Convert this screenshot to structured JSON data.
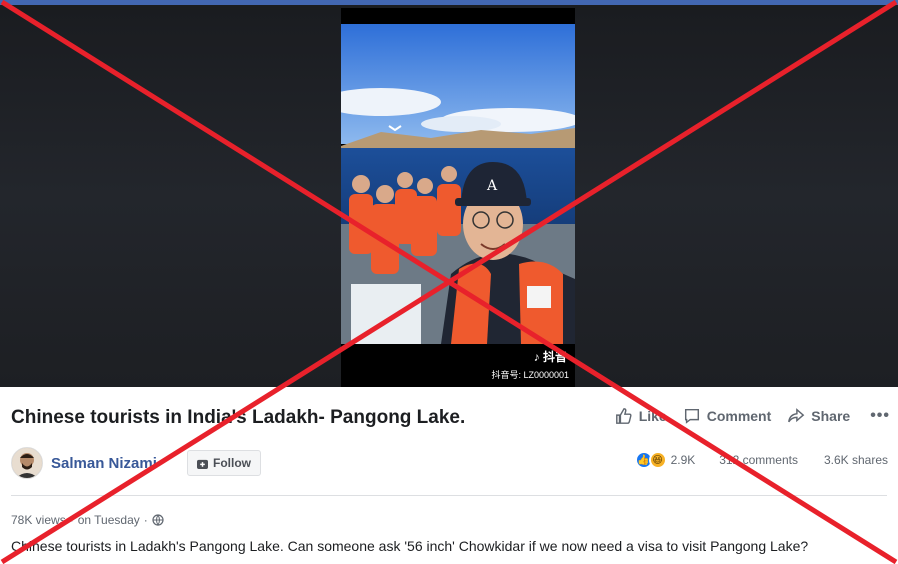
{
  "video": {
    "watermark_logo": "抖音",
    "watermark_id": "抖音号: LZ0000001"
  },
  "post": {
    "title": "Chinese tourists in India's Ladakh- Pangong Lake.",
    "author": "Salman Nizami",
    "follow_label": "Follow",
    "actions": {
      "like": "Like",
      "comment": "Comment",
      "share": "Share",
      "more": "•••"
    },
    "reactions_count": "2.9K",
    "comments_count": "312 comments",
    "shares_count": "3.6K shares",
    "views": "78K views",
    "posted": "on Tuesday",
    "caption": "Chinese tourists in Ladakh's Pangong Lake. Can someone ask '56 inch' Chowkidar if we now need a visa to visit Pangong Lake?"
  },
  "colors": {
    "facebook_blue": "#4267b2",
    "link_blue": "#385898",
    "cross_red": "#e8212b"
  },
  "icons": [
    "thumbs-up-icon",
    "comment-icon",
    "share-icon",
    "follow-icon",
    "globe-icon",
    "like-reaction-icon",
    "haha-reaction-icon",
    "tiktok-icon"
  ]
}
